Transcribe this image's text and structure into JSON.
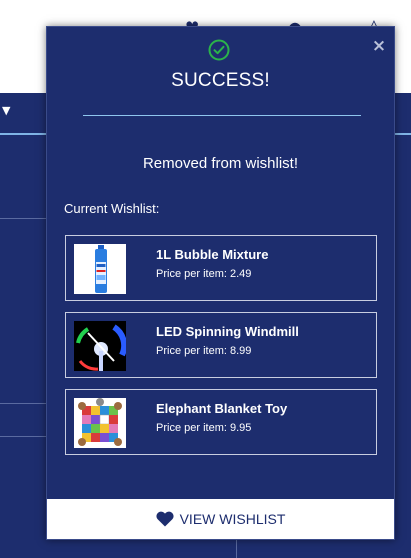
{
  "modal": {
    "title": "SUCCESS!",
    "message": "Removed from wishlist!",
    "wishlist_label": "Current Wishlist:",
    "close_symbol": "×",
    "items": [
      {
        "name": "1L Bubble Mixture",
        "price": "Price per item: 2.49"
      },
      {
        "name": "LED Spinning Windmill",
        "price": "Price per item: 8.99"
      },
      {
        "name": "Elephant Blanket Toy",
        "price": "Price per item: 9.95"
      }
    ],
    "view_button_label": "VIEW WISHLIST"
  },
  "icons": {
    "success": "check-circle-icon",
    "close": "close-icon",
    "heart": "heart-icon"
  },
  "colors": {
    "navy": "#1d2d6e",
    "success_green": "#2bb34a",
    "divider": "#8fc6ee"
  }
}
